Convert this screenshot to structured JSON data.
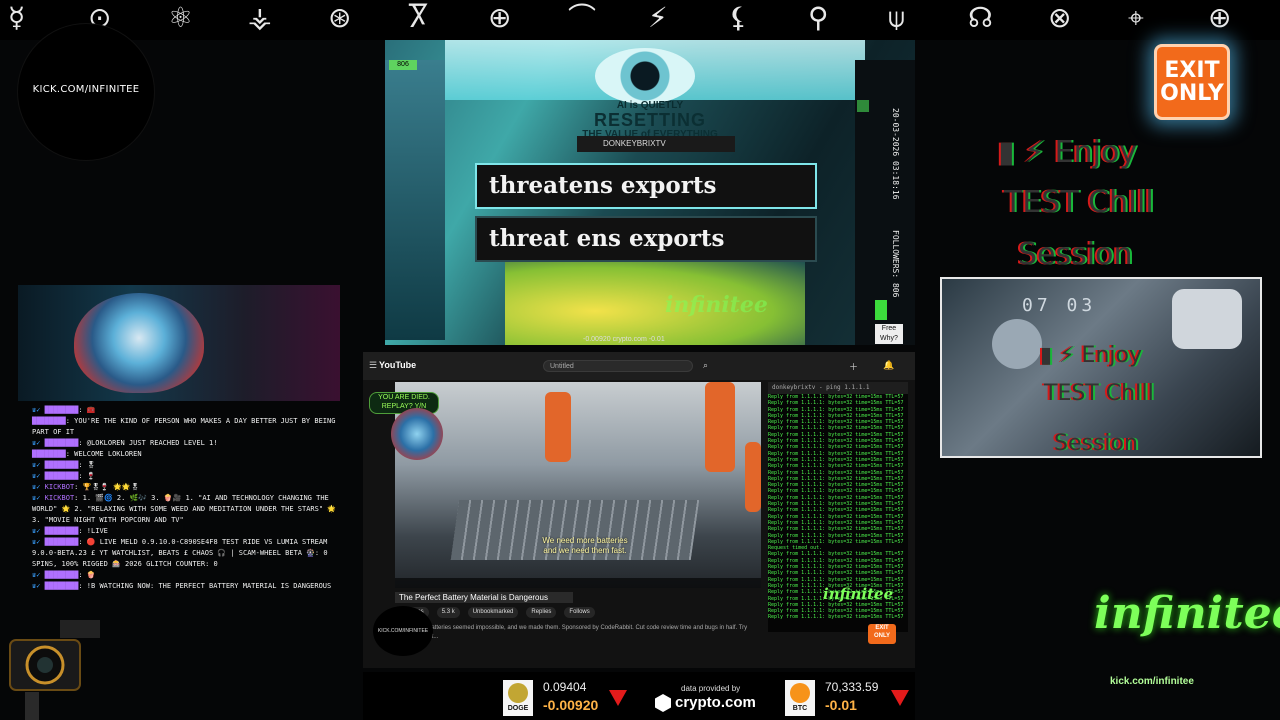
{
  "top_symbols": [
    "☿",
    "⊙",
    "⚛",
    "⚶",
    "⊛",
    "Ⴟ",
    "⊕",
    "⌒",
    "⚡",
    "⚸",
    "⚲",
    "⍦",
    "☊",
    "⊗",
    "⌖",
    "⊕"
  ],
  "kick_circle": {
    "label": "KICK.COM/INFINITEE"
  },
  "exit_badge": {
    "line1": "EXIT",
    "line2": "ONLY"
  },
  "enjoy_overlay": {
    "line1": "▮ ⚡ Enjoy",
    "line2": "TEST ChIll",
    "line3": "Session"
  },
  "center_window": {
    "ai_line": "AI is QUIETLY",
    "resetting": "RESETTING",
    "value_line": "THE VALUE of EVERYTHING",
    "channel": "DONKEYBRIXTV",
    "threat_text_1": "threatens exports",
    "threat_text_2": "threat ens exports",
    "followers": "FOLLOWERS: 806",
    "timestamp": "20-03-2026 03:18:16",
    "badge_806": "806",
    "free_label": "Free Why?",
    "ticker_small": "-0.00920 crypto.com -0.01",
    "watermark": "infinitee"
  },
  "chat": {
    "lines": [
      {
        "badges": "♛✓",
        "user": "████████",
        "text": ": 🧰"
      },
      {
        "badges": "",
        "user": "████████",
        "text": ": YOU'RE THE KIND OF PERSON WHO MAKES A DAY BETTER JUST BY BEING PART OF IT"
      },
      {
        "badges": "♛✓",
        "user": "████████",
        "text": ": @LOKLOREN JUST REACHED LEVEL 1!"
      },
      {
        "badges": "",
        "user": "████████",
        "text": ": WELCOME LOKLOREN"
      },
      {
        "badges": "♛✓",
        "user": "████████",
        "text": ": 🎖"
      },
      {
        "badges": "♛✓",
        "user": "████████",
        "text": ": 🍷"
      },
      {
        "badges": "♛✓",
        "user": "KICKBOT",
        "text": ": 🏆🎖🍷 🌟🌟🎖"
      },
      {
        "badges": "♛✓",
        "user": "KICKBOT",
        "text": ": 1. 🎬🌀 2. 🌿🎶 3. 🍿🎥 1. \"AI AND TECHNOLOGY CHANGING THE WORLD\" 🌟 2. \"RELAXING WITH SOME WEED AND MEDITATION UNDER THE STARS\" 🌟 3. \"MOVIE NIGHT WITH POPCORN AND TV\""
      },
      {
        "badges": "♛✓",
        "user": "████████",
        "text": ": !LIVE"
      },
      {
        "badges": "♛✓",
        "user": "████████",
        "text": ": 🔴 LIVE MELD 0.9.10.0-C890SE4F8 TEST RIDE VS LUMIA STREAM 9.0.0-BETA.23 £ YT WATCHLIST, BEATS £ CHAOS 🎧 | SCAM-WHEEL BETA 🎡: 0 SPINS, 100% RIGGED 🎰 2026 GLITCH COUNTER: 0"
      },
      {
        "badges": "♛✓",
        "user": "████████",
        "text": ": 🍿"
      },
      {
        "badges": "♛✓",
        "user": "████████",
        "text": ": !B WATCHING NOW: THE PERFECT BATTERY MATERIAL IS DANGEROUS"
      }
    ]
  },
  "youtube": {
    "logo": "YouTube",
    "search_value": "Untitled",
    "you_died": "YOU ARE DIED. REPLAY? Y/N",
    "caption_line1": "We need more batteries",
    "caption_line2": "and we need them fast.",
    "video_title": "The Perfect Battery Material is Dangerous",
    "description": "Sign-lithium batteries seemed impossible, and we made them. Sponsored by CodeRabbit. Cut code review time and bugs in half. Try CodeRabbit at...",
    "terminal_header": "donkeybrixtv - ping 1.1.1.1",
    "terminal_line": "Reply from 1.1.1.1: bytes=32 time=15ms TTL=57",
    "terminal_lost": "Request timed out.",
    "stats": [
      "270 likes",
      "5.3 k",
      "Unbookmarked",
      "Replies",
      "Follows"
    ],
    "kick_label": "KICK.COM/INFINITEE",
    "watermark": "infinitee",
    "exit_line1": "EXIT",
    "exit_line2": "ONLY"
  },
  "ticker": {
    "doge": {
      "symbol": "DOGE",
      "price": "0.09404",
      "change": "-0.00920"
    },
    "btc": {
      "symbol": "BTC",
      "price": "70,333.59",
      "change": "-0.01"
    },
    "provided": "data provided by",
    "provider": "crypto.com"
  },
  "right_cam": {
    "line1": "▮ ⚡ Enjoy",
    "line2": "TEST ChIll",
    "line3": "Session",
    "clock": "07 03"
  },
  "logo": {
    "wordmark": "infinitee",
    "url": "kick.com/infinitee"
  },
  "colors": {
    "neon_green": "#7dff5a",
    "exit_orange": "#f26a1b",
    "alert_red": "#e31b1b",
    "chat_user": "#b070ff"
  }
}
